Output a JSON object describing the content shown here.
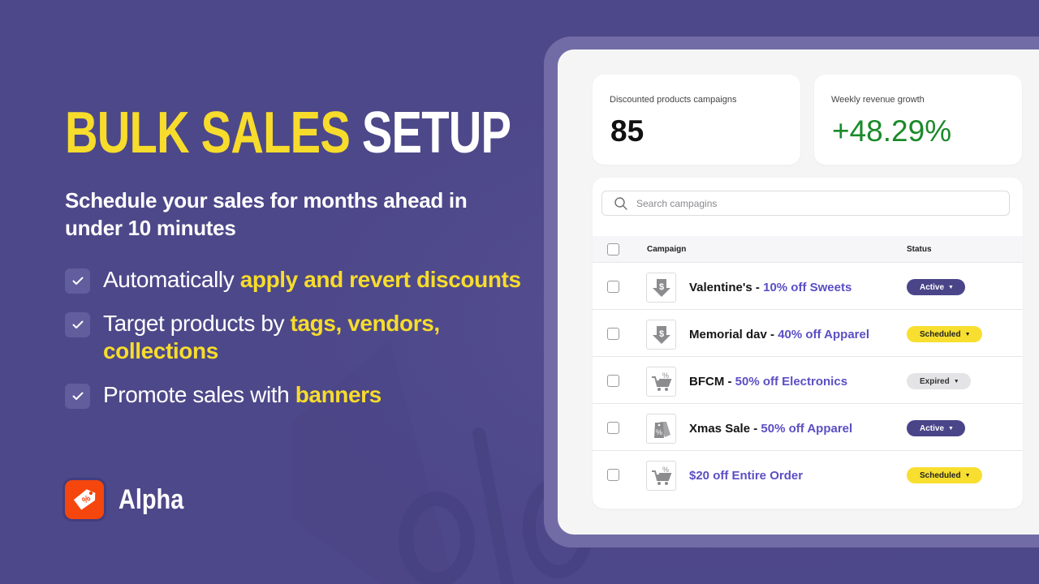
{
  "hero": {
    "title_highlight": "BULK SALES",
    "title_rest": "SETUP",
    "subtitle": "Schedule your sales for months ahead in under 10 minutes"
  },
  "features": [
    {
      "prefix": "Automatically ",
      "highlight": "apply and revert discounts",
      "icon": "check-icon"
    },
    {
      "prefix": "Target products by ",
      "highlight": "tags, vendors, collections",
      "icon": "check-icon"
    },
    {
      "prefix": "Promote sales with ",
      "highlight": "banners",
      "icon": "check-icon"
    }
  ],
  "brand": {
    "name": "Alpha",
    "logo_icon": "percent-tag-icon",
    "logo_color": "#f5460d"
  },
  "colors": {
    "background": "#4d4889",
    "highlight_yellow": "#f7dc2c",
    "link_purple": "#5a4fc4",
    "growth_green": "#1a8a2a"
  },
  "stats": {
    "campaigns": {
      "label": "Discounted products campaigns",
      "value": "85"
    },
    "growth": {
      "label": "Weekly revenue growth",
      "value": "+48.29%"
    }
  },
  "search": {
    "placeholder": "Search campagins",
    "value": ""
  },
  "table": {
    "columns": {
      "campaign": "Campaign",
      "status": "Status"
    },
    "rows": [
      {
        "name": "Valentine's - ",
        "offer": "10% off Sweets",
        "status": "Active",
        "status_type": "active",
        "icon": "dollar-down-arrow-icon"
      },
      {
        "name": "Memorial dav - ",
        "offer": "40% off Apparel",
        "status": "Scheduled",
        "status_type": "scheduled",
        "icon": "dollar-down-arrow-icon"
      },
      {
        "name": "BFCM - ",
        "offer": "50% off Electronics",
        "status": "Expired",
        "status_type": "expired",
        "icon": "cart-percent-icon"
      },
      {
        "name": "Xmas Sale - ",
        "offer": "50% off Apparel",
        "status": "Active",
        "status_type": "active",
        "icon": "price-tags-percent-icon"
      },
      {
        "name": "",
        "offer": "$20 off Entire Order",
        "status": "Scheduled",
        "status_type": "scheduled",
        "icon": "cart-percent-icon"
      }
    ]
  }
}
